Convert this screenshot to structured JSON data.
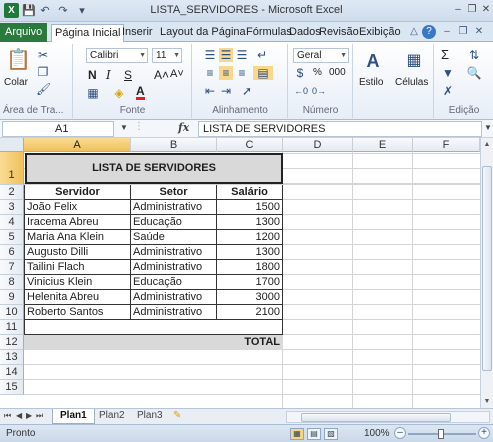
{
  "window": {
    "title": "LISTA_SERVIDORES - Microsoft Excel",
    "app_icon_letter": "X",
    "quick_access": [
      "save-icon",
      "undo-icon",
      "redo-icon",
      "customize-icon"
    ],
    "controls": [
      "minimize-icon",
      "restore-icon",
      "close-icon"
    ]
  },
  "ribbon_tabs": {
    "file": "Arquivo",
    "items": [
      "Página Inicial",
      "Inserir",
      "Layout da Página",
      "Fórmulas",
      "Dados",
      "Revisão",
      "Exibição"
    ],
    "active": "Página Inicial"
  },
  "ribbon": {
    "clipboard": {
      "paste": "Colar",
      "label": "Área de Tra..."
    },
    "font": {
      "name": "Calibri",
      "size": "11",
      "bold": "N",
      "italic": "I",
      "underline": "S",
      "grow": "A˄",
      "shrink": "A˅",
      "color_letter": "A",
      "label": "Fonte"
    },
    "alignment": {
      "label": "Alinhamento"
    },
    "number": {
      "format": "Geral",
      "percent": "%",
      "thousands": "000",
      "label": "Número"
    },
    "style": {
      "label": "Estilo"
    },
    "cells": {
      "label": "Células"
    },
    "editing": {
      "sigma": "Σ",
      "label": "Edição"
    }
  },
  "formula_bar": {
    "name_box": "A1",
    "fx": "fx",
    "content": "LISTA DE SERVIDORES"
  },
  "grid": {
    "columns": [
      "A",
      "B",
      "C",
      "D",
      "E",
      "F"
    ],
    "selected_column": "A",
    "rows": [
      "1",
      "2",
      "3",
      "4",
      "5",
      "6",
      "7",
      "8",
      "9",
      "10",
      "11",
      "12",
      "13",
      "14",
      "15"
    ],
    "selected_row": "1",
    "title": "LISTA DE SERVIDORES",
    "headers": [
      "Servidor",
      "Setor",
      "Salário"
    ],
    "data": [
      [
        "João Felix",
        "Administrativo",
        "1500"
      ],
      [
        "Iracema Abreu",
        "Educação",
        "1300"
      ],
      [
        "Maria Ana Klein",
        "Saúde",
        "1200"
      ],
      [
        "Augusto Dilli",
        "Administrativo",
        "1300"
      ],
      [
        "Tailini Flach",
        "Administrativo",
        "1800"
      ],
      [
        "Vinicius Klein",
        "Educação",
        "1700"
      ],
      [
        "Helenita Abreu",
        "Administrativo",
        "3000"
      ],
      [
        "Roberto Santos",
        "Administrativo",
        "2100"
      ]
    ],
    "total_label": "TOTAL"
  },
  "sheets": {
    "tabs": [
      "Plan1",
      "Plan2",
      "Plan3"
    ],
    "active": "Plan1"
  },
  "status_bar": {
    "mode": "Pronto",
    "zoom": "100%"
  }
}
